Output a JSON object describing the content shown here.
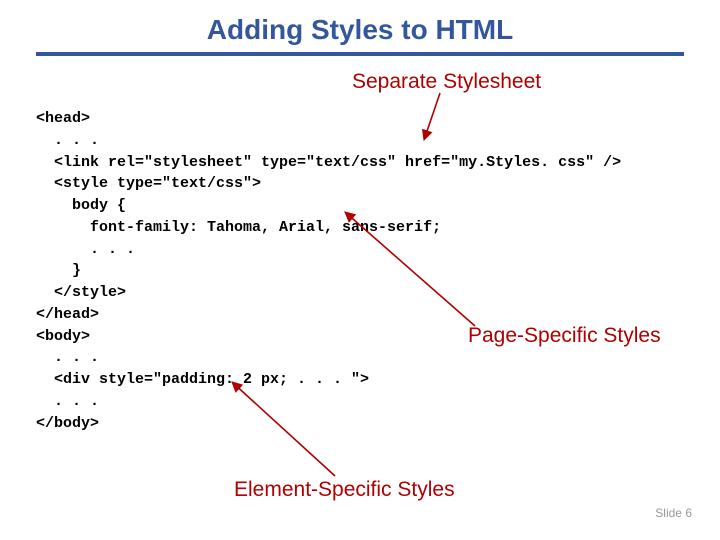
{
  "title": "Adding Styles to HTML",
  "annotations": {
    "separate": "Separate Stylesheet",
    "pageSpecific": "Page-Specific Styles",
    "elementSpecific": "Element-Specific Styles"
  },
  "code": "<head>\n  . . .\n  <link rel=\"stylesheet\" type=\"text/css\" href=\"my.Styles. css\" />\n  <style type=\"text/css\">\n    body {\n      font-family: Tahoma, Arial, sans-serif;\n      . . .\n    }\n  </style>\n</head>\n<body>\n  . . .\n  <div style=\"padding: 2 px; . . . \">\n  . . .\n</body>",
  "footer": "Slide 6"
}
